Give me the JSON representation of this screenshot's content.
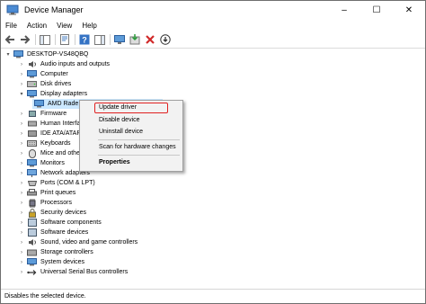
{
  "window": {
    "title": "Device Manager",
    "controls": {
      "minimize": "–",
      "maximize": "☐",
      "close": "✕"
    }
  },
  "menubar": [
    "File",
    "Action",
    "View",
    "Help"
  ],
  "tree": {
    "root": "DESKTOP-VS48QBQ",
    "items": [
      {
        "label": "Audio inputs and outputs",
        "icon": "speaker-icon"
      },
      {
        "label": "Computer",
        "icon": "monitor-icon"
      },
      {
        "label": "Disk drives",
        "icon": "disk-icon"
      },
      {
        "label": "Display adapters",
        "icon": "display-adapter-icon",
        "expanded": true
      },
      {
        "label": "AMD Rade",
        "icon": "display-adapter-icon",
        "child": true,
        "selected": true
      },
      {
        "label": "Firmware",
        "icon": "chip-icon"
      },
      {
        "label": "Human Interfa",
        "icon": "hid-icon"
      },
      {
        "label": "IDE ATA/ATAPI",
        "icon": "ide-icon"
      },
      {
        "label": "Keyboards",
        "icon": "keyboard-icon"
      },
      {
        "label": "Mice and other",
        "icon": "mouse-icon"
      },
      {
        "label": "Monitors",
        "icon": "monitor-icon"
      },
      {
        "label": "Network adapters",
        "icon": "network-icon"
      },
      {
        "label": "Ports (COM & LPT)",
        "icon": "port-icon"
      },
      {
        "label": "Print queues",
        "icon": "printer-icon"
      },
      {
        "label": "Processors",
        "icon": "processor-icon"
      },
      {
        "label": "Security devices",
        "icon": "security-icon"
      },
      {
        "label": "Software components",
        "icon": "software-icon"
      },
      {
        "label": "Software devices",
        "icon": "software-icon"
      },
      {
        "label": "Sound, video and game controllers",
        "icon": "speaker-icon"
      },
      {
        "label": "Storage controllers",
        "icon": "storage-icon"
      },
      {
        "label": "System devices",
        "icon": "system-icon"
      },
      {
        "label": "Universal Serial Bus controllers",
        "icon": "usb-icon"
      }
    ]
  },
  "context_menu": {
    "update_driver": "Update driver",
    "disable_device": "Disable device",
    "uninstall_device": "Uninstall device",
    "scan": "Scan for hardware changes",
    "properties": "Properties"
  },
  "statusbar": {
    "text": "Disables the selected device."
  },
  "colors": {
    "highlight": "#e02020",
    "selection": "#cce8ff"
  }
}
